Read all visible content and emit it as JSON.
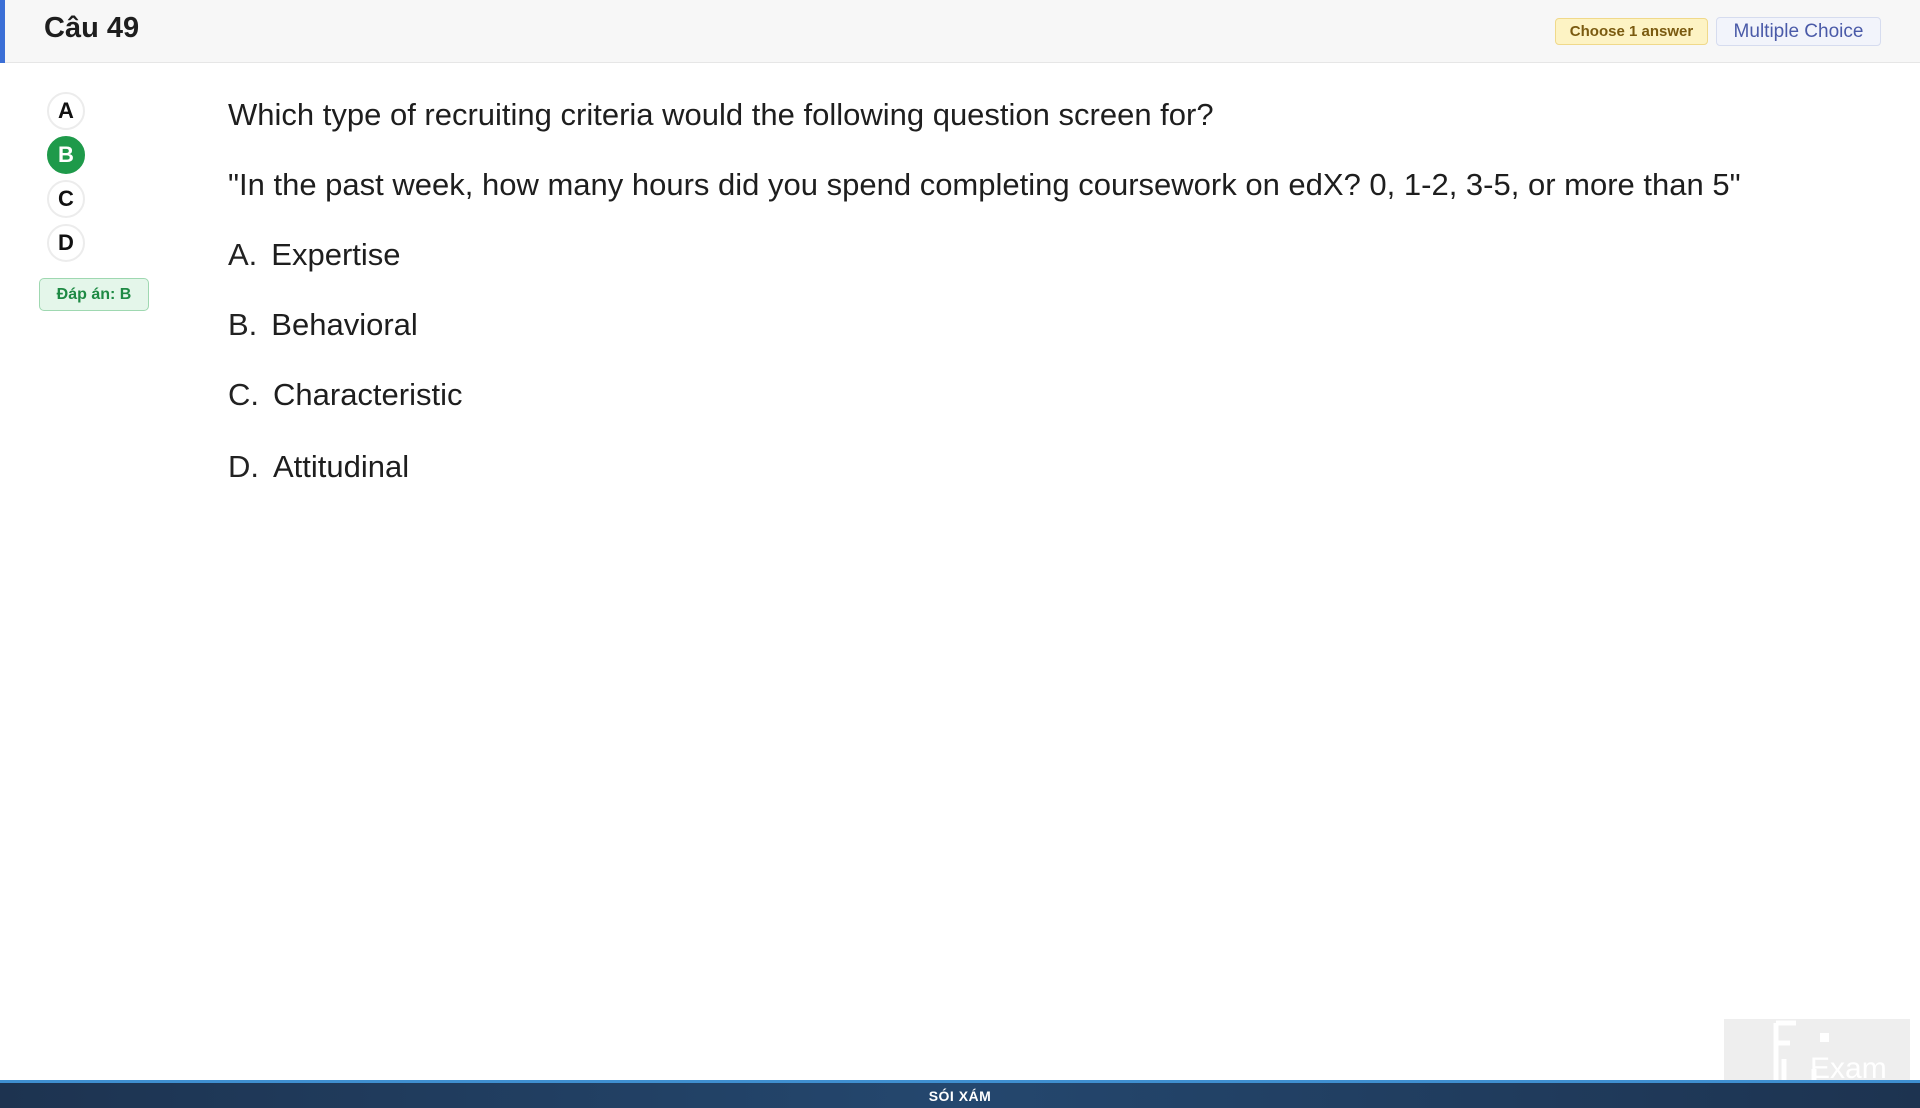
{
  "header": {
    "title": "Câu 49",
    "choose_badge": "Choose 1 answer",
    "type_badge": "Multiple Choice"
  },
  "selector": {
    "options": [
      "A",
      "B",
      "C",
      "D"
    ],
    "selected": "B",
    "answer_label": "Đáp án: B"
  },
  "question": {
    "prompt": "Which type of recruiting criteria would the following question screen for?",
    "quote": "\"In the past week, how many hours did you spend completing coursework on edX? 0, 1-2, 3-5, or more than 5\"",
    "choices": [
      {
        "letter": "A.",
        "text": "Expertise"
      },
      {
        "letter": "B.",
        "text": "Behavioral"
      },
      {
        "letter": "C.",
        "text": "Characteristic"
      },
      {
        "letter": "D.",
        "text": "Attitudinal"
      }
    ]
  },
  "watermark": {
    "logo_text": "Exam"
  },
  "footer": {
    "text": "SÓI XÁM"
  }
}
